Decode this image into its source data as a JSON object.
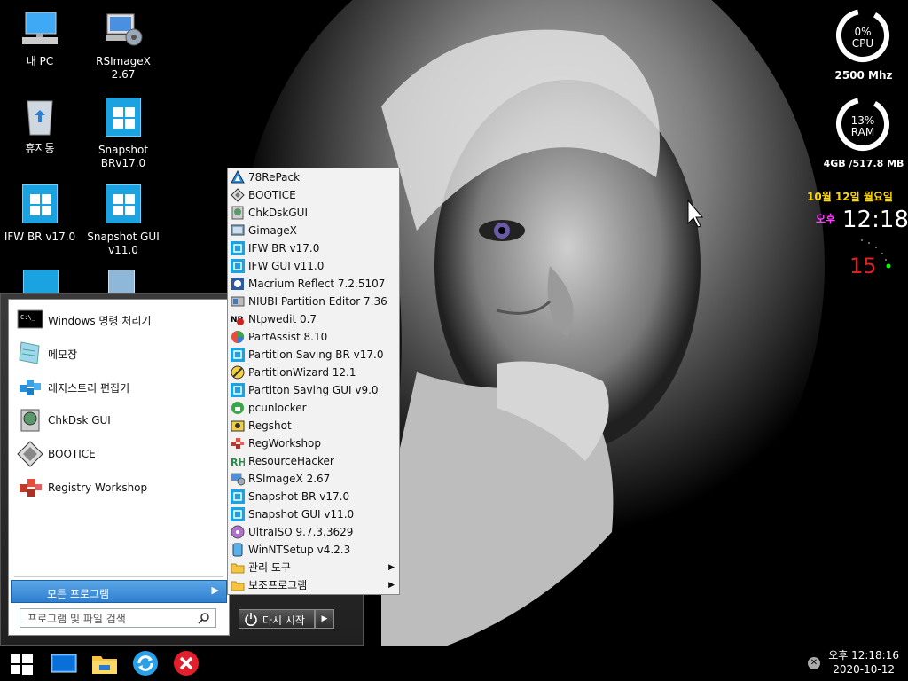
{
  "desktop": {
    "icons": [
      {
        "label": "내 PC",
        "icon": "computer-icon"
      },
      {
        "label": "RSImageX 2.67",
        "icon": "rsimagex-icon"
      },
      {
        "label": "휴지통",
        "icon": "recycle-bin-icon"
      },
      {
        "label": "Snapshot BRv17.0",
        "icon": "windows-tile-icon"
      },
      {
        "label": "IFW BR v17.0",
        "icon": "windows-tile-icon"
      },
      {
        "label": "Snapshot GUI v11.0",
        "icon": "windows-tile-icon"
      }
    ]
  },
  "gadgets": {
    "cpu": {
      "percent": "0%",
      "label": "CPU",
      "freq": "2500 Mhz",
      "level": 0
    },
    "ram": {
      "percent": "13%",
      "label": "RAM",
      "size": "4GB /517.8 MB",
      "level": 0.13
    },
    "date": "10월 12일 월요일",
    "ampm": "오후",
    "time": "12:18",
    "seconds": "15",
    "colors": {
      "date": "#ffd700",
      "ampm": "#ff40ff",
      "seconds": "#e02020",
      "dot": "#00ff00"
    }
  },
  "start_menu": {
    "pinned": [
      {
        "label": "Windows 명령 처리기",
        "icon": "cmd-icon"
      },
      {
        "label": "메모장",
        "icon": "notepad-icon"
      },
      {
        "label": "레지스트리 편집기",
        "icon": "regedit-icon"
      },
      {
        "label": "ChkDsk GUI",
        "icon": "chkdsk-icon"
      },
      {
        "label": "BOOTICE",
        "icon": "bootice-icon"
      },
      {
        "label": "Registry Workshop",
        "icon": "registry-workshop-icon"
      }
    ],
    "all_programs": "모든 프로그램",
    "search_placeholder": "프로그램 및 파일 검색",
    "restart": "다시 시작"
  },
  "submenu": {
    "items": [
      {
        "label": "78RePack",
        "icon": "78repack-icon"
      },
      {
        "label": "BOOTICE",
        "icon": "bootice-icon"
      },
      {
        "label": "ChkDskGUI",
        "icon": "chkdsk-icon"
      },
      {
        "label": "GimageX",
        "icon": "gimagex-icon"
      },
      {
        "label": "IFW BR v17.0",
        "icon": "windows-tile-icon"
      },
      {
        "label": "IFW GUI v11.0",
        "icon": "windows-tile-icon"
      },
      {
        "label": "Macrium Reflect 7.2.5107",
        "icon": "macrium-icon"
      },
      {
        "label": "NIUBI Partition Editor 7.36",
        "icon": "niubi-icon"
      },
      {
        "label": "Ntpwedit 0.7",
        "icon": "ntpwedit-icon"
      },
      {
        "label": "PartAssist 8.10",
        "icon": "partassist-icon"
      },
      {
        "label": "Partition Saving BR v17.0",
        "icon": "windows-tile-icon"
      },
      {
        "label": "PartitionWizard 12.1",
        "icon": "partitionwizard-icon"
      },
      {
        "label": "Partiton Saving GUI v9.0",
        "icon": "windows-tile-icon"
      },
      {
        "label": "pcunlocker",
        "icon": "pcunlocker-icon"
      },
      {
        "label": "Regshot",
        "icon": "regshot-icon"
      },
      {
        "label": "RegWorkshop",
        "icon": "regworkshop-icon"
      },
      {
        "label": "ResourceHacker",
        "icon": "resourcehacker-icon"
      },
      {
        "label": "RSImageX 2.67",
        "icon": "rsimagex-icon"
      },
      {
        "label": "Snapshot BR v17.0",
        "icon": "windows-tile-icon"
      },
      {
        "label": "Snapshot GUI v11.0",
        "icon": "windows-tile-icon"
      },
      {
        "label": "UltraISO 9.7.3.3629",
        "icon": "ultraiso-icon"
      },
      {
        "label": "WinNTSetup v4.2.3",
        "icon": "winntsetup-icon"
      },
      {
        "label": "관리 도구",
        "icon": "folder-icon",
        "submenu": true
      },
      {
        "label": "보조프로그램",
        "icon": "folder-icon",
        "submenu": true
      }
    ]
  },
  "taskbar": {
    "apps": [
      {
        "icon": "windows-start-icon"
      },
      {
        "icon": "monitor-icon"
      },
      {
        "icon": "file-explorer-icon"
      },
      {
        "icon": "refresh-icon"
      },
      {
        "icon": "close-red-icon"
      }
    ],
    "clock_time": "오후 12:18:16",
    "clock_date": "2020-10-12"
  }
}
